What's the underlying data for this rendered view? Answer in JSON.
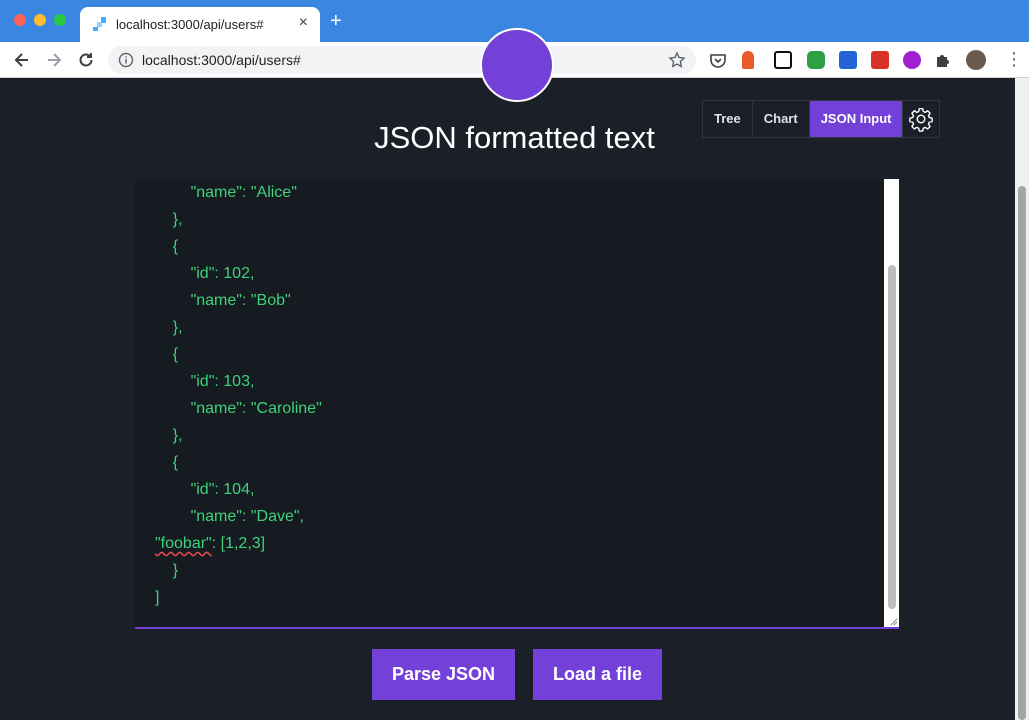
{
  "browser": {
    "tab_title": "localhost:3000/api/users#",
    "url": "localhost:3000/api/users#",
    "close_glyph": "×",
    "new_tab_glyph": "+",
    "menu_glyph": "⋮"
  },
  "view_tabs": [
    {
      "label": "Tree",
      "active": false
    },
    {
      "label": "Chart",
      "active": false
    },
    {
      "label": "JSON Input",
      "active": true
    }
  ],
  "page": {
    "title": "JSON formatted text"
  },
  "editor": {
    "lines": [
      "        \"name\": \"Alice\"",
      "    },",
      "    {",
      "        \"id\": 102,",
      "        \"name\": \"Bob\"",
      "    },",
      "    {",
      "        \"id\": 103,",
      "        \"name\": \"Caroline\"",
      "    },",
      "    {",
      "        \"id\": 104,",
      "        \"name\": \"Dave\",",
      "\"foobar\": [1,2,3]",
      "    }",
      "]"
    ],
    "foobar_key": "\"foobar\"",
    "foobar_rest": ": [1,2,3]"
  },
  "buttons": {
    "parse": "Parse JSON",
    "load": "Load a file"
  },
  "colors": {
    "accent": "#7340d8",
    "background": "#1b2028",
    "code_text": "#3fd27a"
  },
  "icons": [
    "back-icon",
    "forward-icon",
    "reload-icon",
    "info-icon",
    "star-icon",
    "pocket-icon",
    "gear-icon"
  ]
}
